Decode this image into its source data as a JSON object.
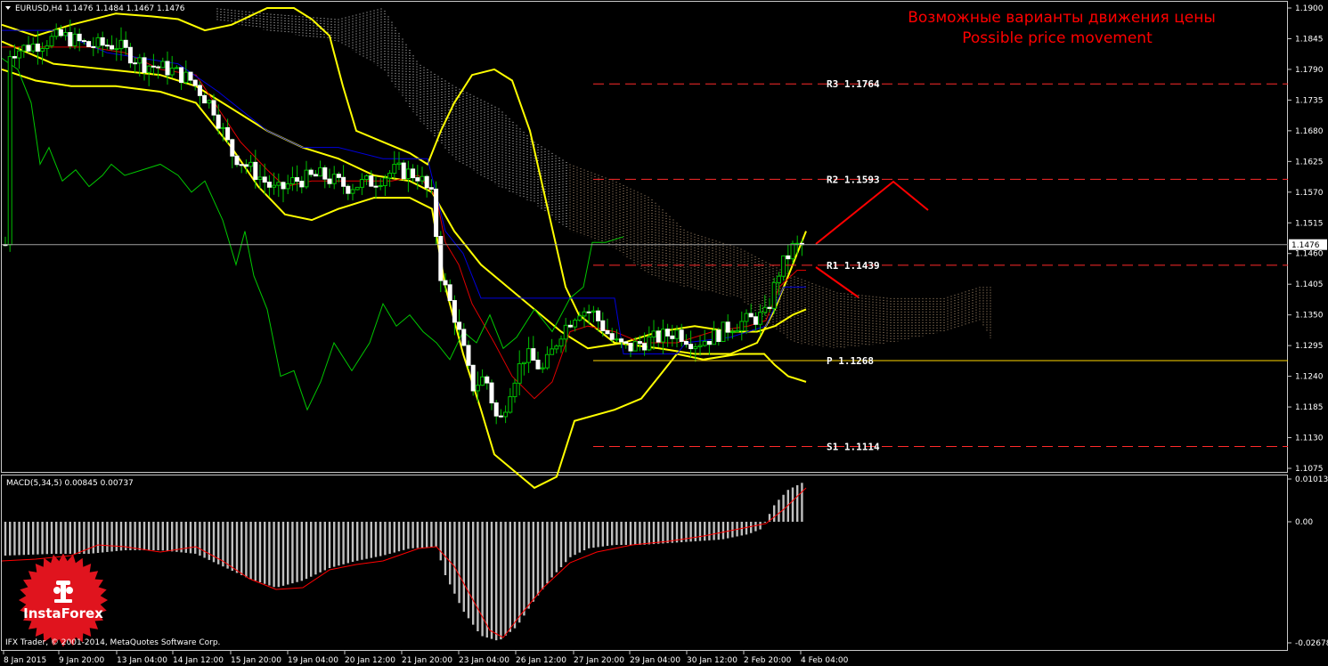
{
  "header": {
    "symbol_info": "EURUSD,H4  1.1476 1.1484 1.1467 1.1476",
    "menu_arrow": "triangle-down-icon"
  },
  "annotation": {
    "title_ru": "Возможные варианты движения цены",
    "title_en": "Possible price movement"
  },
  "levels": [
    {
      "label": "R3 1.1764",
      "value": 1.1764,
      "color": "#ff2a2a"
    },
    {
      "label": "R2 1.1593",
      "value": 1.1593,
      "color": "#ff2a2a"
    },
    {
      "label": "R1 1.1439",
      "value": 1.1439,
      "color": "#ff2a2a"
    },
    {
      "label": "P 1.1268",
      "value": 1.1268,
      "color": "#ffd700"
    },
    {
      "label": "S1 1.1114",
      "value": 1.1114,
      "color": "#ff2a2a"
    }
  ],
  "price_axis": {
    "ticks": [
      "1.1900",
      "1.1845",
      "1.1790",
      "1.1735",
      "1.1680",
      "1.1625",
      "1.1570",
      "1.1515",
      "1.1460",
      "1.1405",
      "1.1350",
      "1.1295",
      "1.1240",
      "1.1185",
      "1.1130",
      "1.1075"
    ],
    "current_price": "1.1476"
  },
  "macd": {
    "label": "MACD(5,34,5) 0.00845 0.00737",
    "ticks": [
      "0.01013",
      "0.00",
      "-0.02678"
    ]
  },
  "time_axis": {
    "labels": [
      "8 Jan 2015",
      "9 Jan 20:00",
      "13 Jan 04:00",
      "14 Jan 12:00",
      "15 Jan 20:00",
      "19 Jan 04:00",
      "20 Jan 12:00",
      "21 Jan 20:00",
      "23 Jan 04:00",
      "26 Jan 12:00",
      "27 Jan 20:00",
      "29 Jan 04:00",
      "30 Jan 12:00",
      "2 Feb 20:00",
      "4 Feb 04:00"
    ]
  },
  "branding": {
    "logo_text": "InstaForex",
    "copyright": "IFX Trader, © 2001-2014, MetaQuotes Software Corp."
  },
  "colors": {
    "background": "#000000",
    "grid": "#ffffff",
    "candle_up": "#ffffff",
    "candle_down": "#ffffff",
    "wick": "#00c000",
    "bollinger": "#ffff00",
    "ichimoku_tenkan": "#ff0000",
    "ichimoku_kijun": "#0000ff",
    "chikou": "#00ff00",
    "annotation": "#ff0000"
  }
}
